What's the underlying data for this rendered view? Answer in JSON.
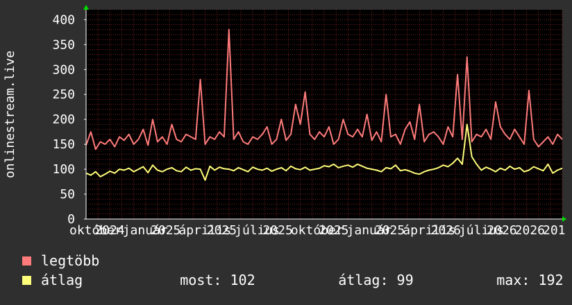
{
  "chart_data": {
    "type": "line",
    "ylabel": "onlinestream.live",
    "ylim": [
      0,
      420
    ],
    "y_ticks": [
      "0",
      "50",
      "100",
      "150",
      "200",
      "250",
      "300",
      "350",
      "400"
    ],
    "x_tick_labels": [
      "október",
      "2024",
      "január",
      "2025",
      "április",
      "2025",
      "július",
      "2025",
      "október",
      "2025",
      "január",
      "2025",
      "április",
      "2026",
      "július",
      "2026",
      "2026",
      "201"
    ],
    "x_range": [
      0,
      1
    ],
    "grid": true,
    "background": "#000000",
    "colors": {
      "legtobb": "#ff7b7b",
      "atlag": "#ffff7b",
      "grid": "#7a2020",
      "axis": "#ffffff",
      "arrow": "#00dd00"
    },
    "series": [
      {
        "name": "legtöbb",
        "x": [
          0.0,
          0.01,
          0.02,
          0.03,
          0.04,
          0.05,
          0.06,
          0.07,
          0.08,
          0.09,
          0.1,
          0.11,
          0.12,
          0.13,
          0.14,
          0.15,
          0.16,
          0.17,
          0.18,
          0.19,
          0.2,
          0.21,
          0.22,
          0.23,
          0.24,
          0.25,
          0.26,
          0.27,
          0.28,
          0.29,
          0.3,
          0.31,
          0.32,
          0.33,
          0.34,
          0.35,
          0.36,
          0.37,
          0.38,
          0.39,
          0.4,
          0.41,
          0.42,
          0.43,
          0.44,
          0.45,
          0.46,
          0.47,
          0.48,
          0.49,
          0.5,
          0.51,
          0.52,
          0.53,
          0.54,
          0.55,
          0.56,
          0.57,
          0.58,
          0.59,
          0.6,
          0.61,
          0.62,
          0.63,
          0.64,
          0.65,
          0.66,
          0.67,
          0.68,
          0.69,
          0.7,
          0.71,
          0.72,
          0.73,
          0.74,
          0.75,
          0.76,
          0.77,
          0.78,
          0.79,
          0.8,
          0.81,
          0.82,
          0.83,
          0.84,
          0.85,
          0.86,
          0.87,
          0.88,
          0.89,
          0.9,
          0.91,
          0.92,
          0.93,
          0.94,
          0.95,
          0.96,
          0.97,
          0.98,
          0.99,
          1.0
        ],
        "values": [
          148,
          175,
          140,
          155,
          150,
          160,
          145,
          165,
          158,
          170,
          150,
          160,
          180,
          148,
          200,
          155,
          165,
          150,
          190,
          160,
          155,
          170,
          165,
          160,
          280,
          150,
          165,
          160,
          175,
          165,
          380,
          160,
          175,
          155,
          150,
          165,
          160,
          170,
          185,
          150,
          160,
          200,
          158,
          170,
          230,
          190,
          255,
          170,
          160,
          175,
          165,
          185,
          150,
          160,
          200,
          170,
          165,
          180,
          165,
          210,
          158,
          175,
          155,
          250,
          165,
          170,
          150,
          180,
          195,
          160,
          230,
          155,
          170,
          175,
          165,
          150,
          185,
          165,
          290,
          160,
          325,
          155,
          170,
          165,
          180,
          160,
          235,
          185,
          170,
          160,
          180,
          165,
          150,
          258,
          160,
          145,
          155,
          165,
          150,
          170,
          160
        ]
      },
      {
        "name": "átlag",
        "x": [
          0.0,
          0.01,
          0.02,
          0.03,
          0.04,
          0.05,
          0.06,
          0.07,
          0.08,
          0.09,
          0.1,
          0.11,
          0.12,
          0.13,
          0.14,
          0.15,
          0.16,
          0.17,
          0.18,
          0.19,
          0.2,
          0.21,
          0.22,
          0.23,
          0.24,
          0.25,
          0.26,
          0.27,
          0.28,
          0.29,
          0.3,
          0.31,
          0.32,
          0.33,
          0.34,
          0.35,
          0.36,
          0.37,
          0.38,
          0.39,
          0.4,
          0.41,
          0.42,
          0.43,
          0.44,
          0.45,
          0.46,
          0.47,
          0.48,
          0.49,
          0.5,
          0.51,
          0.52,
          0.53,
          0.54,
          0.55,
          0.56,
          0.57,
          0.58,
          0.59,
          0.6,
          0.61,
          0.62,
          0.63,
          0.64,
          0.65,
          0.66,
          0.67,
          0.68,
          0.69,
          0.7,
          0.71,
          0.72,
          0.73,
          0.74,
          0.75,
          0.76,
          0.77,
          0.78,
          0.79,
          0.8,
          0.81,
          0.82,
          0.83,
          0.84,
          0.85,
          0.86,
          0.87,
          0.88,
          0.89,
          0.9,
          0.91,
          0.92,
          0.93,
          0.94,
          0.95,
          0.96,
          0.97,
          0.98,
          0.99,
          1.0
        ],
        "values": [
          92,
          88,
          95,
          85,
          90,
          96,
          92,
          100,
          98,
          102,
          95,
          100,
          105,
          93,
          108,
          98,
          95,
          100,
          103,
          97,
          95,
          104,
          98,
          101,
          100,
          78,
          106,
          98,
          104,
          101,
          100,
          97,
          103,
          99,
          95,
          104,
          100,
          98,
          102,
          96,
          100,
          103,
          97,
          106,
          101,
          99,
          104,
          98,
          100,
          102,
          107,
          105,
          110,
          103,
          106,
          108,
          104,
          110,
          106,
          102,
          100,
          98,
          95,
          103,
          101,
          108,
          97,
          99,
          96,
          92,
          90,
          95,
          98,
          100,
          103,
          108,
          105,
          112,
          122,
          110,
          190,
          125,
          110,
          98,
          104,
          100,
          95,
          102,
          98,
          106,
          100,
          103,
          95,
          98,
          105,
          101,
          97,
          110,
          92,
          98,
          102
        ]
      }
    ],
    "legend": [
      {
        "label": "legtöbb"
      },
      {
        "label": "átlag"
      }
    ],
    "stats": {
      "now_label": "most:",
      "now_value": "102",
      "avg_label": "átlag:",
      "avg_value": "99",
      "max_label": "max:",
      "max_value": "192"
    }
  }
}
